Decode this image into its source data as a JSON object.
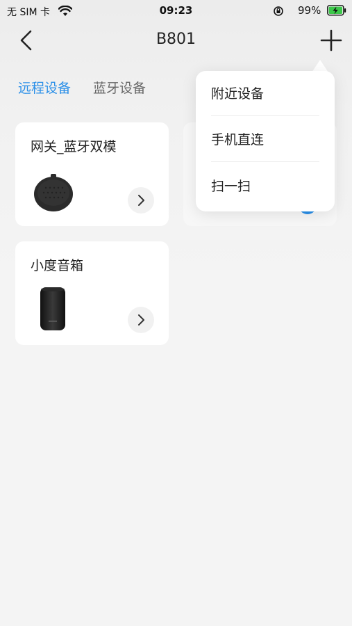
{
  "status_bar": {
    "carrier": "无 SIM 卡",
    "time": "09:23",
    "battery_percent": "99%",
    "icons": [
      "wifi-icon",
      "orientation-lock-icon",
      "battery-charging-icon"
    ]
  },
  "nav": {
    "title": "B801",
    "back_icon": "chevron-left-icon",
    "add_icon": "plus-icon"
  },
  "tabs": [
    {
      "label": "远程设备",
      "active": true
    },
    {
      "label": "蓝牙设备",
      "active": false
    }
  ],
  "devices": [
    {
      "name": "网关_蓝牙双模",
      "icon": "gateway-device-image"
    },
    {
      "name": "小度音箱",
      "icon": "smart-speaker-image"
    }
  ],
  "menu": {
    "items": [
      {
        "label": "附近设备"
      },
      {
        "label": "手机直连"
      },
      {
        "label": "扫一扫"
      }
    ]
  },
  "colors": {
    "accent": "#2a8fe8",
    "background": "#f4f4f4",
    "card": "#ffffff"
  }
}
